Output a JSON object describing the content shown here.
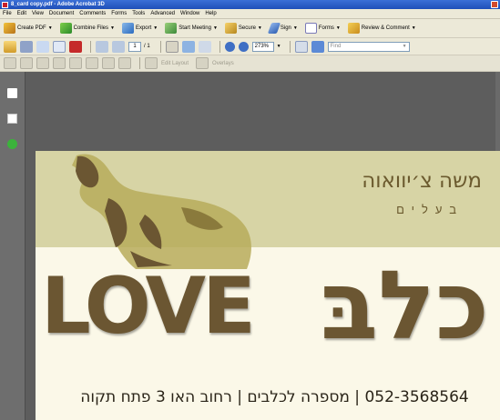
{
  "window": {
    "title": "8_card copy.pdf - Adobe Acrobat 3D"
  },
  "menu": [
    "File",
    "Edit",
    "View",
    "Document",
    "Comments",
    "Forms",
    "Tools",
    "Advanced",
    "Window",
    "Help"
  ],
  "toolbar1": [
    {
      "label": "Create PDF",
      "icon": "create-pdf-icon"
    },
    {
      "label": "Combine Files",
      "icon": "combine-files-icon"
    },
    {
      "label": "Export",
      "icon": "export-icon"
    },
    {
      "label": "Start Meeting",
      "icon": "meeting-icon"
    },
    {
      "label": "Secure",
      "icon": "lock-icon"
    },
    {
      "label": "Sign",
      "icon": "pen-icon"
    },
    {
      "label": "Forms",
      "icon": "forms-icon"
    },
    {
      "label": "Review & Comment",
      "icon": "review-icon"
    }
  ],
  "toolbar2": {
    "page_current": "1",
    "page_total": "/ 1",
    "zoom": "273%",
    "find_placeholder": "Find"
  },
  "toolbar3": [
    {
      "label": "Edit Layout"
    },
    {
      "label": "Overlays"
    }
  ],
  "card": {
    "name": "משה צ׳יוואוה",
    "profession": "בעלים",
    "love_word": "LOVE",
    "hebrew_word": "כלבּ",
    "contact": "052-3568564 | מספרה לכלבים | רחוב האו 3 פתח תקוה"
  },
  "colors": {
    "card_top": "#d7d4a5",
    "brown_text": "#6b5632",
    "doc_bg": "#5d5d5d"
  }
}
